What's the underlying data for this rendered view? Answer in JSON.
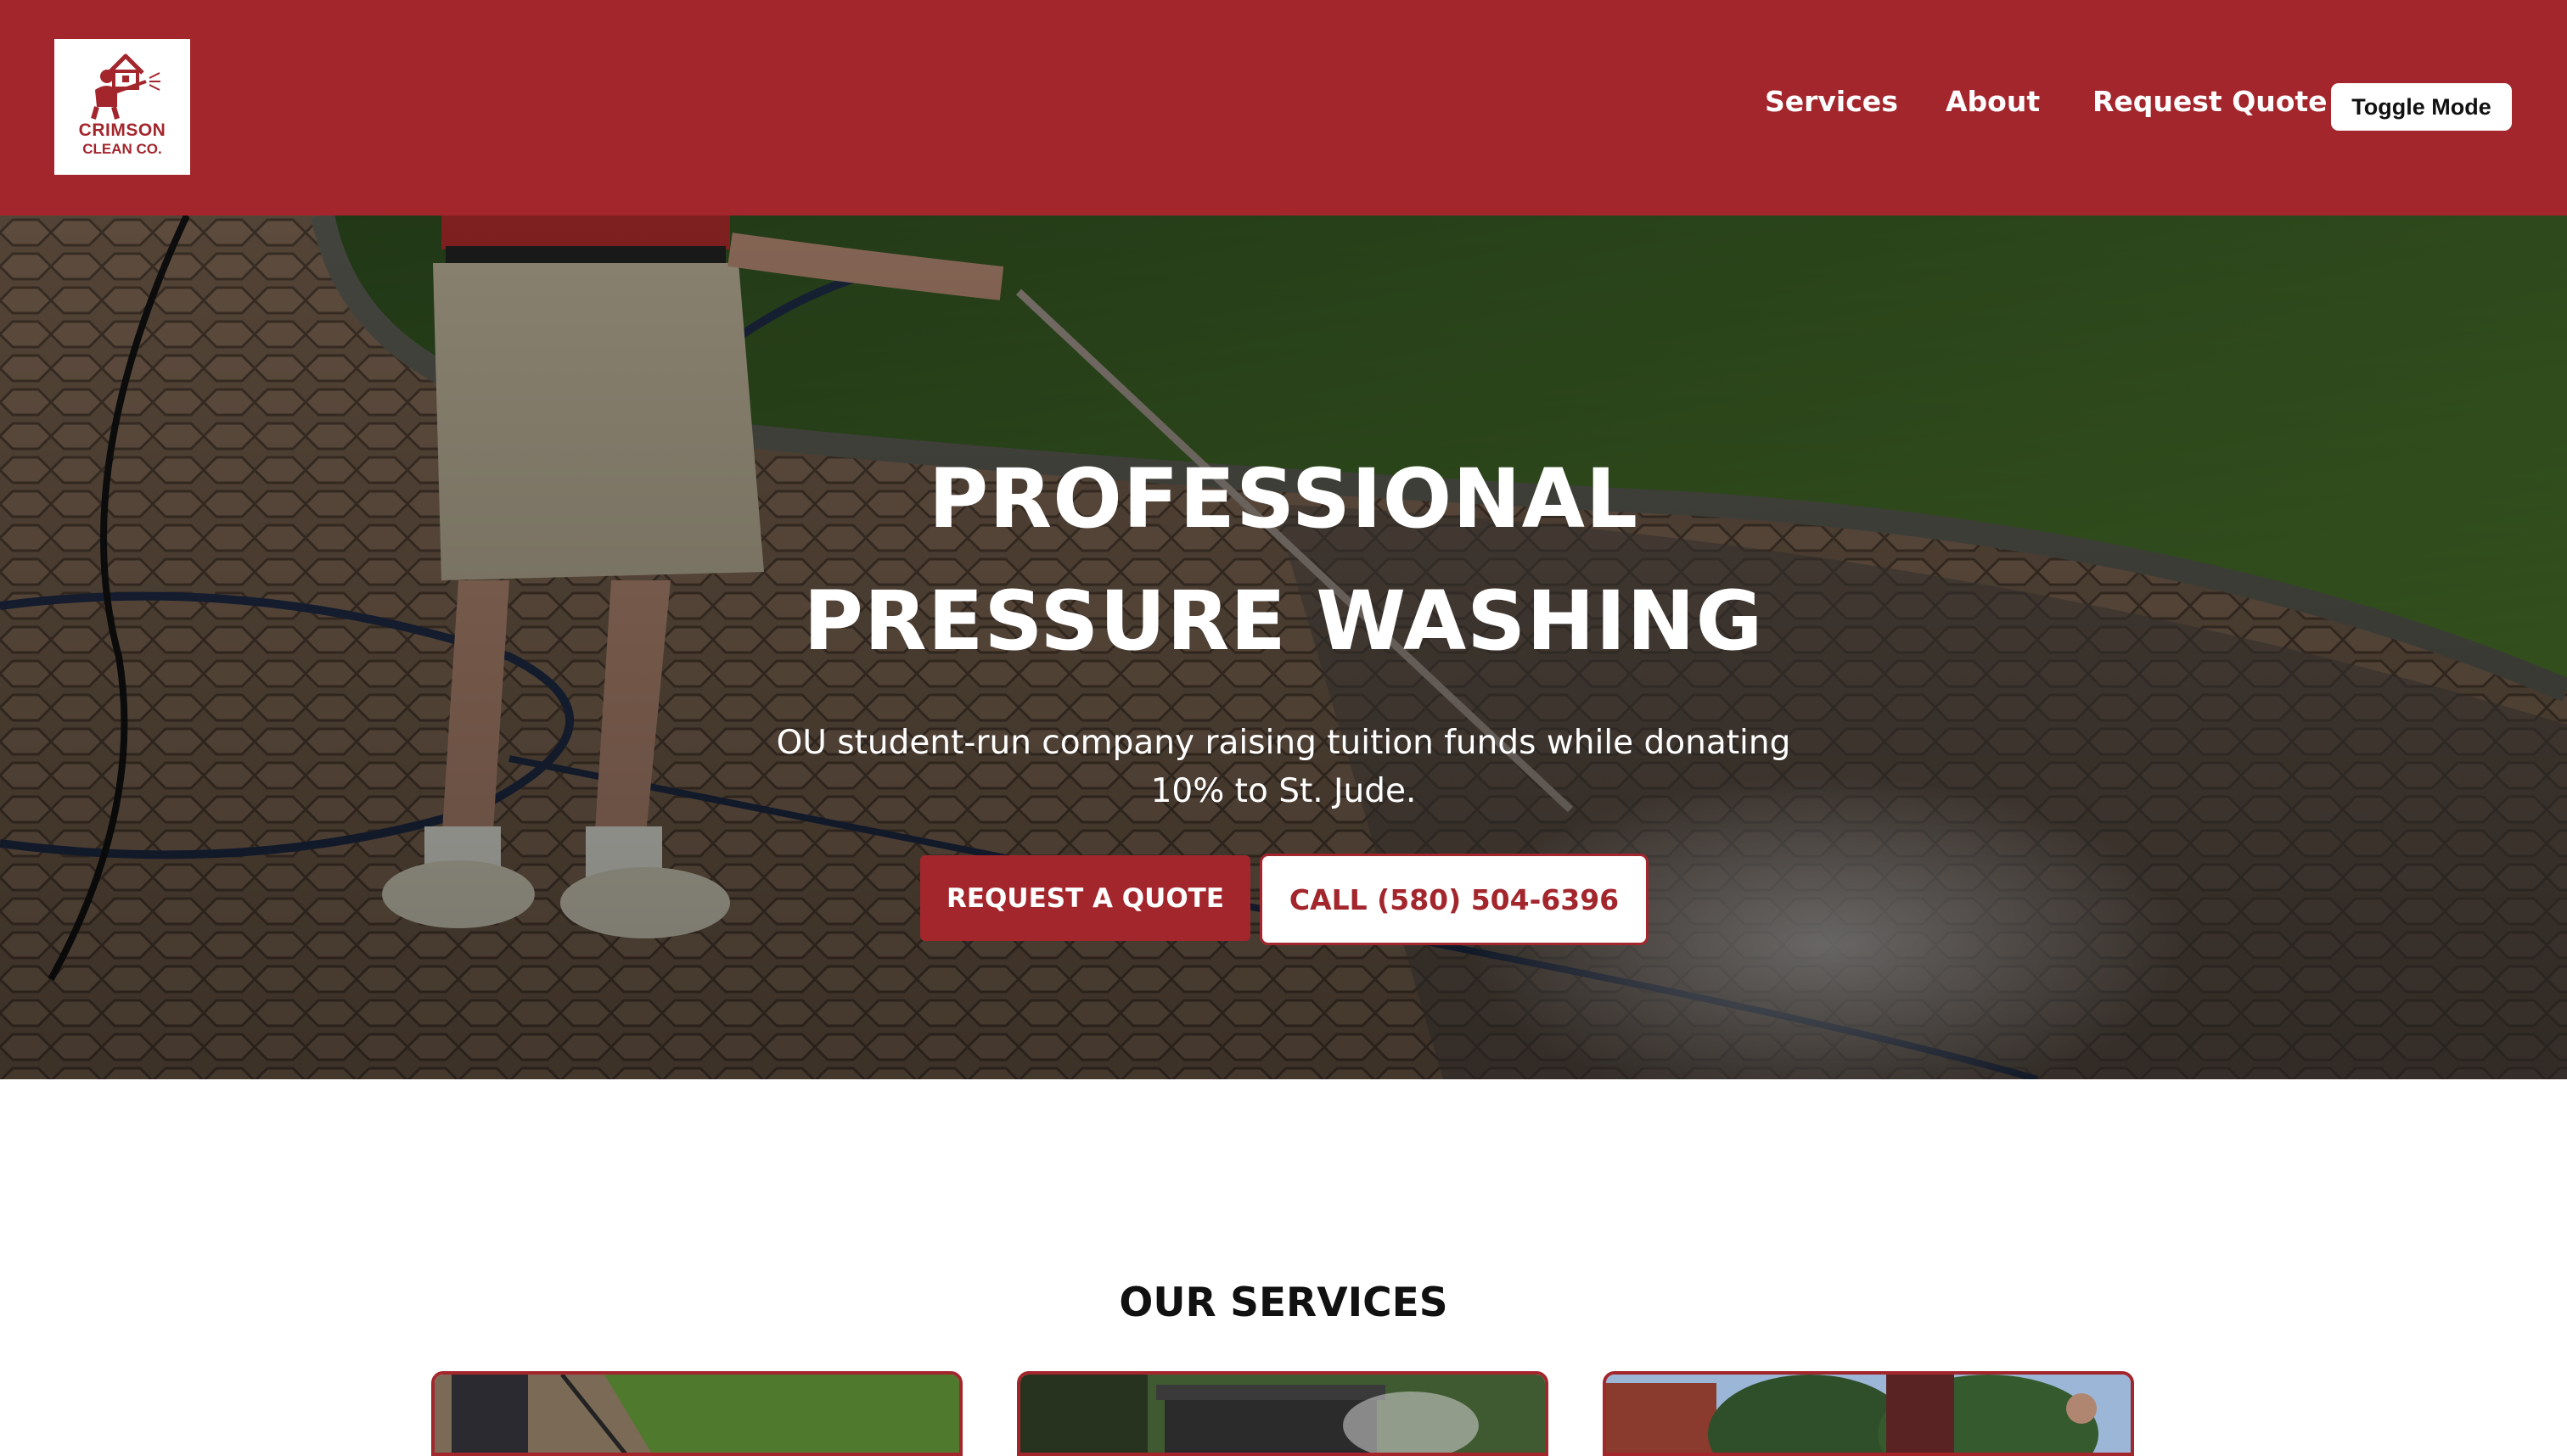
{
  "brand": {
    "name_line1": "CRIMSON",
    "name_line2": "CLEAN CO.",
    "color": "#a3262d"
  },
  "nav": {
    "items": [
      {
        "label": "Services"
      },
      {
        "label": "About"
      },
      {
        "label": "Request Quote"
      }
    ],
    "toggle_label": "Toggle Mode"
  },
  "hero": {
    "title_line1": "PROFESSIONAL",
    "title_line2": "PRESSURE WASHING",
    "subtitle_line1": "OU student-run company raising tuition funds while donating",
    "subtitle_line2": "10% to St. Jude.",
    "primary_button": "REQUEST A QUOTE",
    "secondary_button": "CALL (580) 504-6396"
  },
  "services": {
    "heading": "OUR SERVICES",
    "cards": [
      {
        "image": "driveway-washing-photo"
      },
      {
        "image": "trash-bin-cleaning-photo"
      },
      {
        "image": "house-washing-photo"
      }
    ]
  },
  "icons": {
    "logo": "pressure-washer-worker-house-icon"
  }
}
